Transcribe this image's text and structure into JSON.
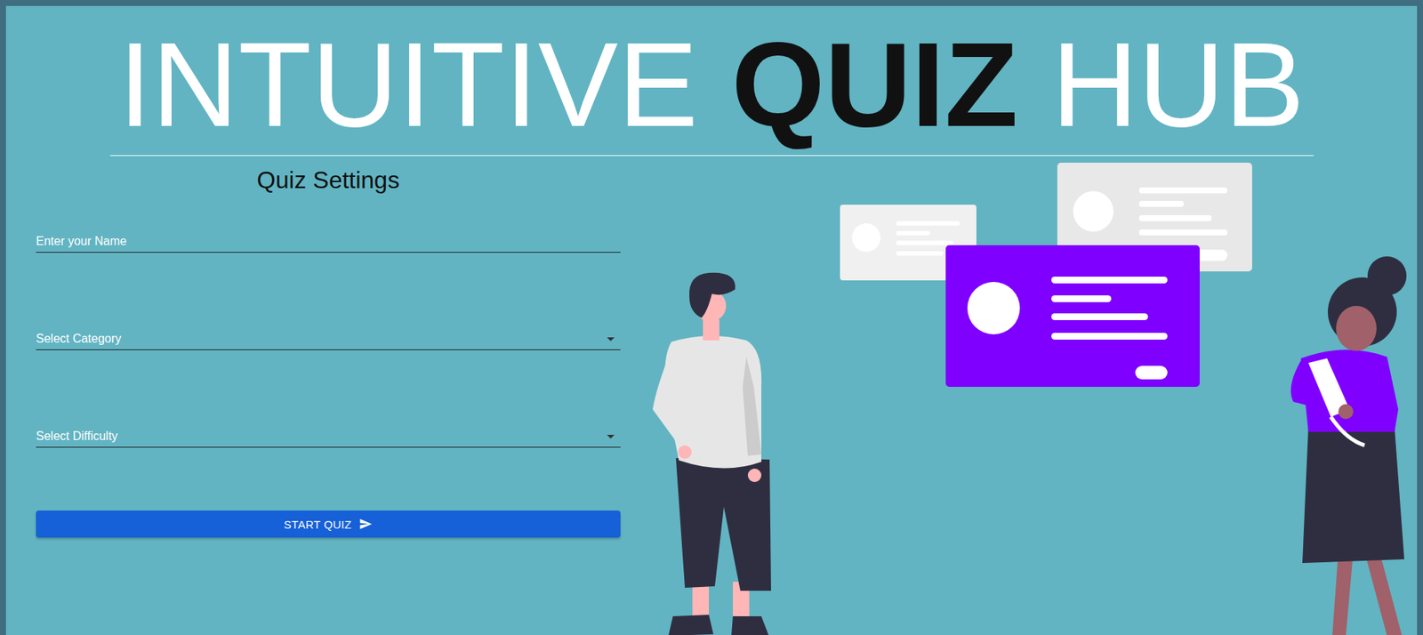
{
  "title": {
    "parts": [
      {
        "text": "INTUITIVE",
        "emphasis": false
      },
      {
        "text": "QUIZ",
        "emphasis": true
      },
      {
        "text": "HUB",
        "emphasis": false
      }
    ]
  },
  "form": {
    "heading": "Quiz Settings",
    "fields": [
      {
        "kind": "text",
        "placeholder": "Enter your Name"
      },
      {
        "kind": "select",
        "placeholder": "Select Category"
      },
      {
        "kind": "select",
        "placeholder": "Select Difficulty"
      }
    ],
    "submit": {
      "label": "START QUIZ"
    }
  }
}
